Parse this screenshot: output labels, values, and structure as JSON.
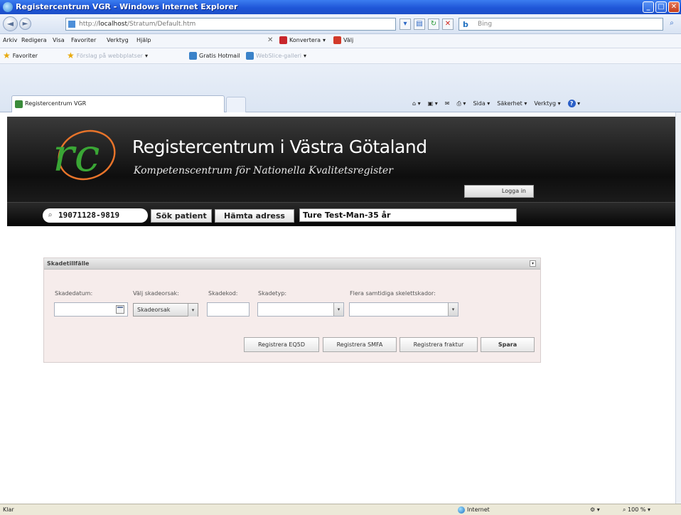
{
  "window": {
    "title": "Registercentrum VGR - Windows Internet Explorer"
  },
  "browser": {
    "address_prefix": "http://",
    "address_host": "localhost",
    "address_path": "/Stratum/Default.htm",
    "search_provider": "bing",
    "search_placeholder": "Bing",
    "menu": [
      "Arkiv",
      "Redigera",
      "Visa",
      "Favoriter",
      "Verktyg",
      "Hjälp"
    ],
    "toolbar_convert": "Konvertera",
    "toolbar_select": "Välj",
    "favorites_label": "Favoriter",
    "favorites_items": [
      "Förslag på webbplatser",
      "Gratis Hotmail",
      "WebSlice-galleri"
    ],
    "tab_label": "Registercentrum VGR",
    "command_bar": [
      "Sida",
      "Säkerhet",
      "Verktyg"
    ],
    "status_left": "Klar",
    "status_zone": "Internet",
    "status_zoom": "100 %"
  },
  "header": {
    "logo_text": "rc",
    "title": "Registercentrum i Västra Götaland",
    "subtitle": "Kompetenscentrum för Nationella Kvalitetsregister",
    "login_label": "Logga in"
  },
  "search": {
    "personnummer": "19071128-9819",
    "search_patient_label": "Sök patient",
    "fetch_address_label": "Hämta adress",
    "patient_display": "Ture Test-Man-35 år"
  },
  "panel": {
    "title": "Skadetillfälle",
    "fields": {
      "date_label": "Skadedatum:",
      "cause_label": "Välj skadeorsak:",
      "cause_value": "Skadeorsak",
      "code_label": "Skadekod:",
      "type_label": "Skadetyp:",
      "multi_label": "Flera samtidiga skelettskador:"
    },
    "actions": {
      "eq5d": "Registrera EQ5D",
      "smfa": "Registrera SMFA",
      "fraktur": "Registrera fraktur",
      "save": "Spara"
    }
  },
  "colors": {
    "header_bg": "#0e0e0e",
    "logo_orange": "#e8742a",
    "logo_green": "#3aa635",
    "panel_bg": "#f6eceb"
  }
}
